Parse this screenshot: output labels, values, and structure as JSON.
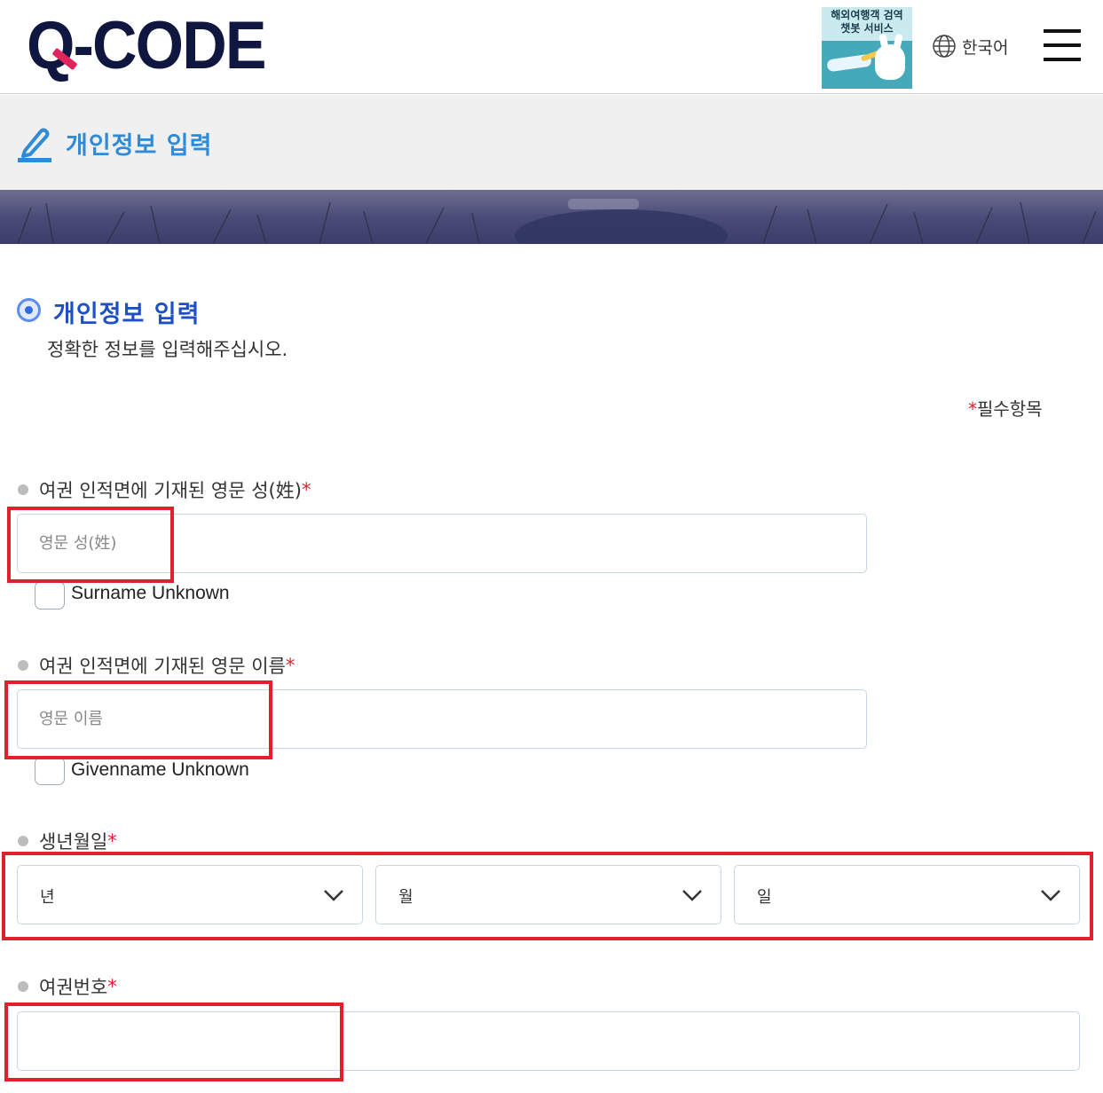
{
  "header": {
    "logo_text": "-CODE",
    "logo_q": "Q",
    "chatbot_text": "해외여행객 검역\n챗봇 서비스",
    "language_label": "한국어"
  },
  "titlebar": {
    "title": "개인정보 입력"
  },
  "section": {
    "title": "개인정보 입력",
    "subtitle": "정확한 정보를 입력해주십시오.",
    "required_mark": "*",
    "required_label": "필수항목"
  },
  "fields": {
    "surname": {
      "label": "여권 인적면에 기재된 영문 성(姓)",
      "required_mark": "*",
      "placeholder": "영문 성(姓)",
      "value": "",
      "unknown_label": "Surname Unknown",
      "unknown_checked": false
    },
    "givenname": {
      "label": "여권 인적면에 기재된 영문 이름",
      "required_mark": "*",
      "placeholder": "영문 이름",
      "value": "",
      "unknown_label": "Givenname Unknown",
      "unknown_checked": false
    },
    "birthdate": {
      "label": "생년월일",
      "required_mark": "*",
      "year": "년",
      "month": "월",
      "day": "일"
    },
    "passport": {
      "label": "여권번호",
      "required_mark": "*",
      "placeholder": "",
      "value": ""
    }
  },
  "colors": {
    "accent_blue": "#2f8bd8",
    "section_blue": "#1e4fc4",
    "required_red": "#e0202c",
    "logo_navy": "#0f1640",
    "logo_pink": "#e0245e",
    "highlight_red": "#e0202c"
  },
  "icons": [
    "globe-icon",
    "menu-icon",
    "pen-icon",
    "chevron-down-icon"
  ]
}
